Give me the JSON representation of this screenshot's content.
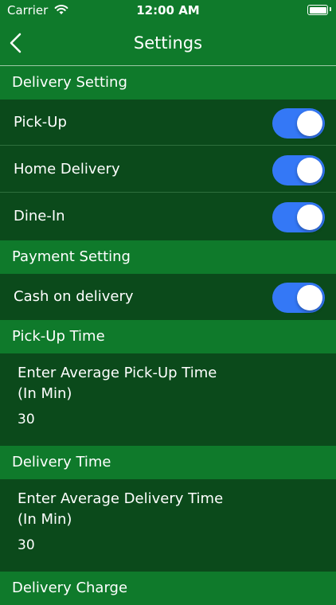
{
  "status_bar": {
    "carrier": "Carrier",
    "time": "12:00 AM"
  },
  "nav": {
    "title": "Settings"
  },
  "sections": {
    "delivery_setting": "Delivery Setting",
    "payment_setting": "Payment Setting",
    "pickup_time": "Pick-Up Time",
    "delivery_time": "Delivery Time",
    "delivery_charge": "Delivery Charge"
  },
  "toggles": {
    "pickup": {
      "label": "Pick-Up",
      "on": true
    },
    "home_delivery": {
      "label": "Home Delivery",
      "on": true
    },
    "dine_in": {
      "label": "Dine-In",
      "on": true
    },
    "cash_on_delivery": {
      "label": "Cash on delivery",
      "on": true
    }
  },
  "inputs": {
    "pickup_time": {
      "label": "Enter Average Pick-Up Time (In Min)",
      "value": "30"
    },
    "delivery_time": {
      "label": "Enter Average Delivery Time (In Min)",
      "value": "30"
    }
  },
  "colors": {
    "header_green": "#0f7a2b",
    "row_green": "#0b4a1b",
    "toggle_blue": "#3478f6"
  },
  "icons": {
    "back": "chevron-left-icon",
    "wifi": "wifi-icon",
    "battery": "battery-icon"
  }
}
